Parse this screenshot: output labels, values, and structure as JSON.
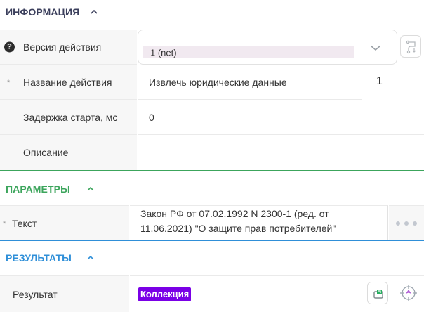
{
  "sections": {
    "info": {
      "title": "ИНФОРМАЦИЯ",
      "color": "#3b3f5c"
    },
    "params": {
      "title": "ПАРАМЕТРЫ",
      "color": "#3ca55c"
    },
    "results": {
      "title": "РЕЗУЛЬТАТЫ",
      "color": "#2f8fd8"
    }
  },
  "info": {
    "version": {
      "label": "Версия действия",
      "value": "1 (net)"
    },
    "name": {
      "label": "Название действия",
      "value": "Извлечь юридические данные",
      "counter": "1"
    },
    "delay": {
      "label": "Задержка старта, мс",
      "value": "0"
    },
    "description": {
      "label": "Описание",
      "value": ""
    }
  },
  "params": {
    "text": {
      "label": "Текст",
      "value_line1": "Закон РФ от 07.02.1992 N 2300-1 (ред. от",
      "value_line2": "11.06.2021) \"О защите прав потребителей\""
    }
  },
  "results": {
    "result": {
      "label": "Результат",
      "badge": "Коллекция",
      "badge_color": "#7a00e6"
    }
  },
  "icons": {
    "help": "question-circle-icon",
    "dropdown": "chevron-down-icon",
    "variable": "variable-path-icon",
    "more": "ellipsis-icon",
    "export": "export-icon",
    "target": "target-icon"
  }
}
